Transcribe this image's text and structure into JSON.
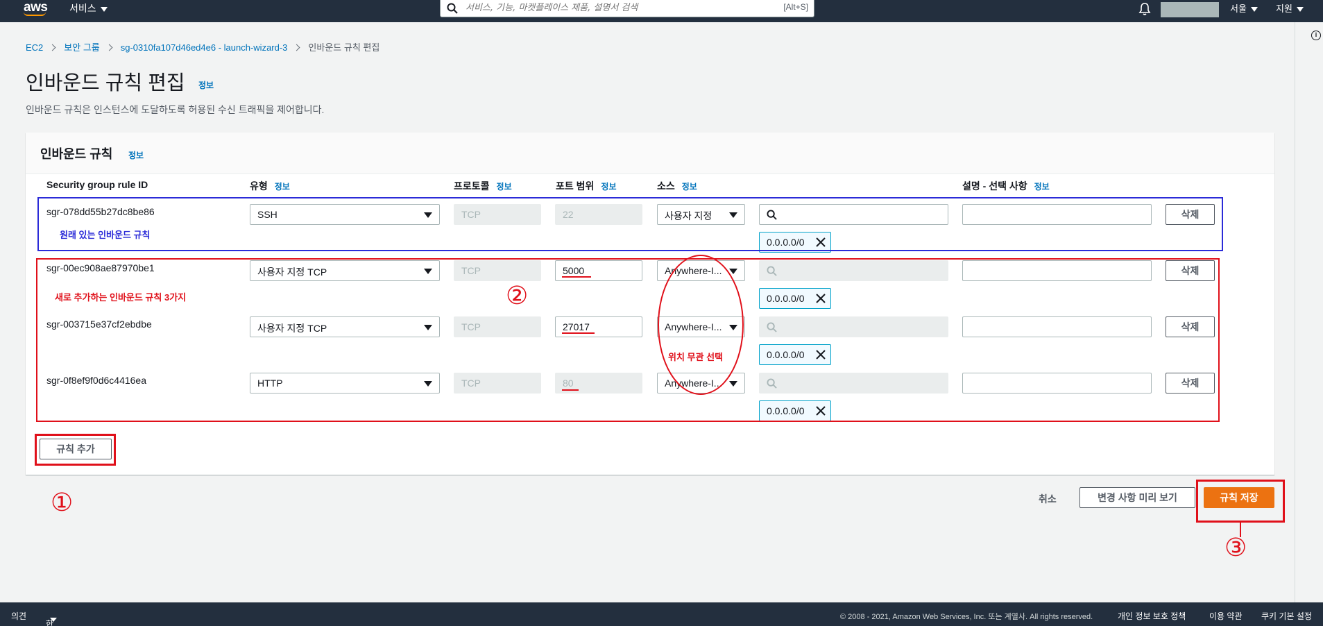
{
  "topnav": {
    "logo": "aws",
    "services_label": "서비스",
    "search_placeholder": "서비스, 기능, 마켓플레이스 제품, 설명서 검색",
    "search_shortcut": "[Alt+S]",
    "region_label": "서울",
    "support_label": "지원"
  },
  "breadcrumb": [
    "EC2",
    "보안 그룹",
    "sg-0310fa107d46ed4e6 - launch-wizard-3",
    "인바운드 규칙 편집"
  ],
  "page": {
    "title": "인바운드 규칙 편집",
    "info_label": "정보",
    "description": "인바운드 규칙은 인스턴스에 도달하도록 허용된 수신 트래픽을 제어합니다."
  },
  "panel": {
    "title": "인바운드 규칙",
    "info_label": "정보",
    "columns": {
      "rule_id": "Security group rule ID",
      "type": "유형",
      "protocol": "프로토콜",
      "port_range": "포트 범위",
      "source": "소스",
      "description": "설명 - 선택 사항"
    },
    "rules": [
      {
        "id": "sgr-078dd55b27dc8be86",
        "type": "SSH",
        "protocol": "TCP",
        "port": "22",
        "source": "사용자 지정",
        "cidr": "0.0.0.0/0",
        "delete_label": "삭제"
      },
      {
        "id": "sgr-00ec908ae87970be1",
        "type": "사용자 지정 TCP",
        "protocol": "TCP",
        "port": "5000",
        "source": "Anywhere-I...",
        "cidr": "0.0.0.0/0",
        "delete_label": "삭제"
      },
      {
        "id": "sgr-003715e37cf2ebdbe",
        "type": "사용자 지정 TCP",
        "protocol": "TCP",
        "port": "27017",
        "source": "Anywhere-I...",
        "cidr": "0.0.0.0/0",
        "delete_label": "삭제"
      },
      {
        "id": "sgr-0f8ef9f0d6c4416ea",
        "type": "HTTP",
        "protocol": "TCP",
        "port": "80",
        "source": "Anywhere-I...",
        "cidr": "0.0.0.0/0",
        "delete_label": "삭제"
      }
    ],
    "add_rule_label": "규칙 추가"
  },
  "actions": {
    "cancel_label": "취소",
    "preview_label": "변경 사항 미리 보기",
    "save_label": "규칙 저장"
  },
  "annotations": {
    "existing_rule": "원래 있는 인바운드 규칙",
    "new_rules": "새로 추가하는 인바운드 규칙 3가지",
    "anywhere": "위치 무관 선택",
    "step1": "①",
    "step2": "②",
    "step3": "③",
    "blue": "#2b2bd8",
    "red": "#e0101a"
  },
  "footer": {
    "feedback": "의견",
    "language": "한국어",
    "copyright": "© 2008 - 2021, Amazon Web Services, Inc. 또는 계열사. All rights reserved.",
    "privacy": "개인 정보 보호 정책",
    "terms": "이용 약관",
    "cookies": "쿠키 기본 설정"
  },
  "colors": {
    "nav_bg": "#232f3e",
    "link": "#0073bb",
    "primary": "#ec7211",
    "token_border": "#00a1c9"
  }
}
